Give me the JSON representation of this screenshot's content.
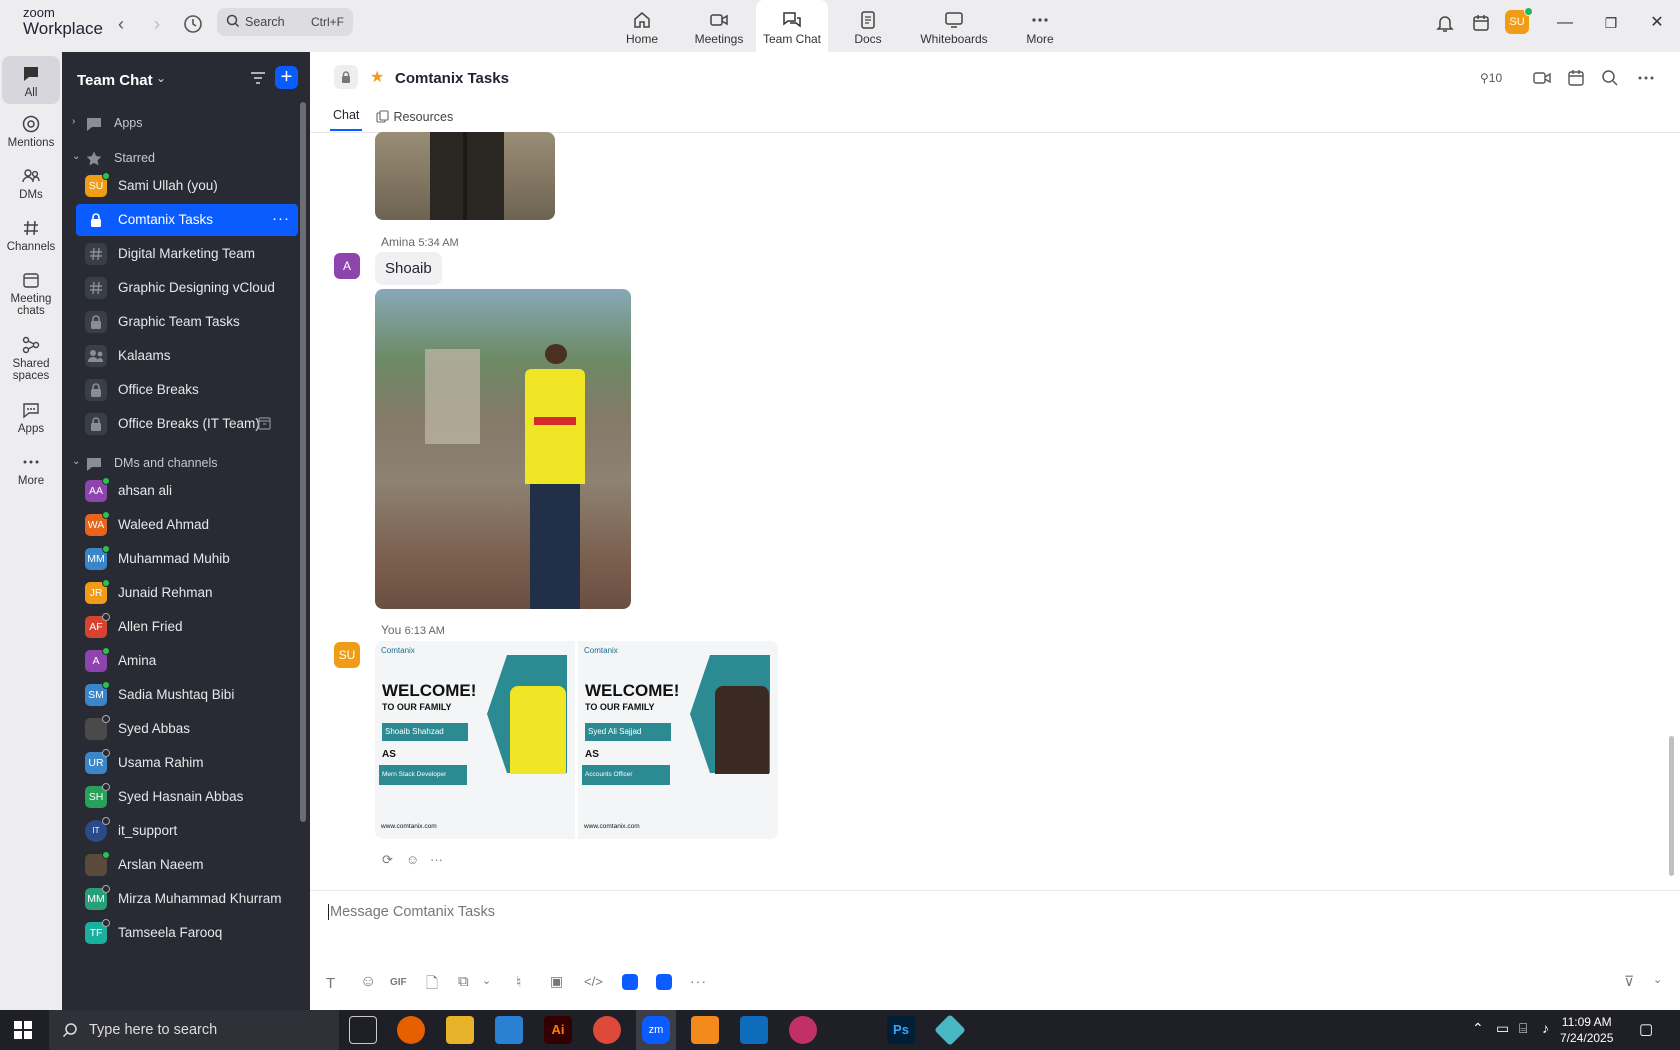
{
  "app": {
    "logo_line1": "zoom",
    "logo_line2": "Workplace"
  },
  "search": {
    "label": "Search",
    "shortcut": "Ctrl+F"
  },
  "topnav": [
    {
      "label": "Home",
      "icon": "home-icon"
    },
    {
      "label": "Meetings",
      "icon": "video-icon"
    },
    {
      "label": "Team Chat",
      "icon": "chat-icon",
      "active": true
    },
    {
      "label": "Docs",
      "icon": "docs-icon"
    },
    {
      "label": "Whiteboards",
      "icon": "whiteboard-icon"
    },
    {
      "label": "More",
      "icon": "more-icon"
    }
  ],
  "user": {
    "initials": "SU",
    "avatar_color": "#f19c16"
  },
  "rail": [
    {
      "label": "All",
      "icon": "chat-icon",
      "active": true
    },
    {
      "label": "Mentions",
      "icon": "at-icon"
    },
    {
      "label": "DMs",
      "icon": "people-icon"
    },
    {
      "label": "Channels",
      "icon": "hash-icon"
    },
    {
      "label": "Meeting chats",
      "icon": "calendar-icon"
    },
    {
      "label": "Shared spaces",
      "icon": "share-icon"
    },
    {
      "label": "Apps",
      "icon": "apps-icon"
    },
    {
      "label": "More",
      "icon": "more-icon"
    }
  ],
  "sidebar": {
    "title": "Team Chat",
    "sections": {
      "apps": "Apps",
      "starred": "Starred",
      "dms": "DMs and channels"
    },
    "starred": [
      {
        "name": "Sami Ullah (you)",
        "initials": "SU",
        "color": "#f19c16",
        "presence": "online"
      },
      {
        "name": "Comtanix Tasks",
        "icon": "lock-icon",
        "selected": true
      },
      {
        "name": "Digital Marketing Team",
        "icon": "hash-icon"
      },
      {
        "name": "Graphic Designing vCloud",
        "icon": "hash-icon"
      },
      {
        "name": "Graphic Team Tasks",
        "icon": "lock-icon"
      },
      {
        "name": "Kalaams",
        "icon": "group-icon"
      },
      {
        "name": "Office Breaks",
        "icon": "lock-icon"
      },
      {
        "name": "Office Breaks (IT Team)",
        "icon": "lock-icon"
      }
    ],
    "dms": [
      {
        "name": "ahsan ali",
        "initials": "AA",
        "color": "#8e44ad",
        "presence": "online"
      },
      {
        "name": "Waleed Ahmad",
        "initials": "WA",
        "color": "#e8631c",
        "presence": "online"
      },
      {
        "name": "Muhammad Muhib",
        "initials": "MM",
        "color": "#3a86c8",
        "presence": "online"
      },
      {
        "name": "Junaid Rehman",
        "initials": "JR",
        "color": "#f19c16",
        "presence": "online"
      },
      {
        "name": "Allen Fried",
        "initials": "AF",
        "color": "#d8432f",
        "presence": "offline"
      },
      {
        "name": "Amina",
        "initials": "A",
        "color": "#8e44ad",
        "presence": "online"
      },
      {
        "name": "Sadia Mushtaq Bibi",
        "initials": "SM",
        "color": "#3a86c8",
        "presence": "online"
      },
      {
        "name": "Syed Abbas",
        "initials": "",
        "color": "#4a4a4a",
        "presence": "offline"
      },
      {
        "name": "Usama Rahim",
        "initials": "UR",
        "color": "#3a86c8",
        "presence": "offline"
      },
      {
        "name": "Syed Hasnain Abbas",
        "initials": "SH",
        "color": "#27a05a",
        "presence": "offline"
      },
      {
        "name": "it_support",
        "initials": "IT",
        "color": "#2b4a8a",
        "presence": "offline"
      },
      {
        "name": "Arslan Naeem",
        "initials": "",
        "color": "#5a4a3a",
        "presence": "online"
      },
      {
        "name": "Mirza Muhammad Khurram",
        "initials": "MM",
        "color": "#27a07a",
        "presence": "offline"
      },
      {
        "name": "Tamseela Farooq",
        "initials": "TF",
        "color": "#1ab0a0",
        "presence": "offline"
      }
    ]
  },
  "channel": {
    "title": "Comtanix Tasks",
    "members": "10",
    "tabs": [
      "Chat",
      "Resources"
    ]
  },
  "messages": [
    {
      "author": "Amina",
      "time": "5:34 AM",
      "initial": "A",
      "color": "#8e44ad",
      "text": "Shoaib"
    },
    {
      "author": "You",
      "time": "6:13 AM",
      "initial": "SU",
      "color": "#f19c16"
    }
  ],
  "cards": [
    {
      "brand": "Comtanix",
      "welcome": "WELCOME!",
      "sub": "TO OUR FAMILY",
      "name": "Shoaib Shahzad",
      "as": "AS",
      "role": "Mern Stack Developer",
      "site": "www.comtanix.com"
    },
    {
      "brand": "Comtanix",
      "welcome": "WELCOME!",
      "sub": "TO OUR FAMILY",
      "name": "Syed Ali Sajjad",
      "as": "AS",
      "role": "Accounts Officer",
      "site": "www.comtanix.com"
    }
  ],
  "composer": {
    "placeholder": "Message Comtanix Tasks",
    "gif": "GIF"
  },
  "taskbar": {
    "search": "Type here to search",
    "time": "11:09 AM",
    "date": "7/24/2025"
  }
}
